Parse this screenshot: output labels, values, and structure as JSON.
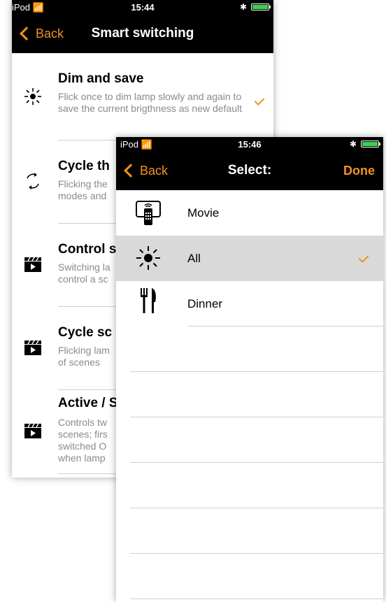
{
  "back_screen": {
    "status": {
      "carrier": "iPod",
      "time": "15:44"
    },
    "nav": {
      "back": "Back",
      "title": "Smart switching"
    },
    "items": [
      {
        "title": "Dim and save",
        "desc": "Flick once to dim lamp slowly and again to save the current brigthness as new default",
        "checked": true
      },
      {
        "title": "Cycle th",
        "desc": "Flicking the modes and"
      },
      {
        "title": "Control s",
        "desc": "Switching la control a sc"
      },
      {
        "title": "Cycle sc",
        "desc": "Flicking lam of scenes"
      },
      {
        "title": "Active / S",
        "desc": "Controls tw scenes; firs switched O when lamp"
      }
    ]
  },
  "front_screen": {
    "status": {
      "carrier": "iPod",
      "time": "15:46"
    },
    "nav": {
      "back": "Back",
      "title": "Select:",
      "done": "Done"
    },
    "options": [
      {
        "label": "Movie",
        "icon": "tv-remote-icon",
        "selected": false
      },
      {
        "label": "All",
        "icon": "sun-icon",
        "selected": true
      },
      {
        "label": "Dinner",
        "icon": "fork-knife-icon",
        "selected": false
      }
    ]
  },
  "colors": {
    "accent": "#f0931f",
    "bar": "#000000",
    "selected_row": "#d9d9d9"
  }
}
